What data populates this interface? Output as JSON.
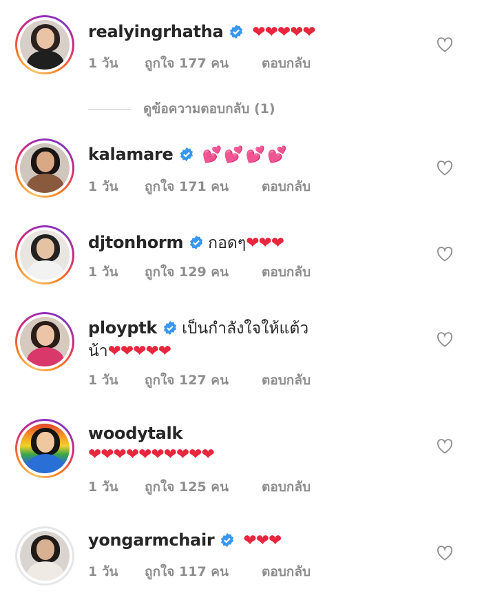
{
  "comments": [
    {
      "username": "realyingrhatha",
      "verified": true,
      "text": "",
      "hearts": "❤❤❤❤❤",
      "time": "1 วัน",
      "likes": "ถูกใจ 177 คน",
      "reply": "ตอบกลับ",
      "avatar_colors": {
        "bg": "#d8cfc9",
        "hair": "#2b2220",
        "skin": "#e8c3a6",
        "body": "#1f1f1f"
      }
    },
    {
      "username": "kalamare",
      "verified": true,
      "text": "",
      "hearts": "💕💕💕💕",
      "time": "1 วัน",
      "likes": "ถูกใจ 171 คน",
      "reply": "ตอบกลับ",
      "avatar_colors": {
        "bg": "#cfc6bd",
        "hair": "#1a1412",
        "skin": "#d9a885",
        "body": "#8a5a3e"
      }
    },
    {
      "username": "djtonhorm",
      "verified": true,
      "text": "กอดๆ",
      "hearts": "❤❤❤",
      "time": "1 วัน",
      "likes": "ถูกใจ 129 คน",
      "reply": "ตอบกลับ",
      "avatar_colors": {
        "bg": "#e9e6e2",
        "hair": "#222222",
        "skin": "#e6c2a4",
        "body": "#f2f2f2"
      }
    },
    {
      "username": "ployptk",
      "verified": true,
      "text": "เป็นกำลังใจให้แต้ว",
      "text_line2": "น้า",
      "hearts": "❤❤❤❤❤",
      "time": "1 วัน",
      "likes": "ถูกใจ 127 คน",
      "reply": "ตอบกลับ",
      "avatar_colors": {
        "bg": "#d6c9bd",
        "hair": "#2a1d18",
        "skin": "#ecc5a8",
        "body": "#d9386b"
      }
    },
    {
      "username": "woodytalk",
      "verified": false,
      "text": "",
      "hearts": "❤❤❤❤❤❤❤❤❤❤",
      "time": "1 วัน",
      "likes": "ถูกใจ 125 คน",
      "reply": "ตอบกลับ",
      "avatar_colors": {
        "bg": "#e4432f",
        "hair": "#151515",
        "skin": "#f0c8a0",
        "body": "#2a6fd6"
      }
    },
    {
      "username": "yongarmchair",
      "verified": true,
      "text": "",
      "hearts": "❤❤❤",
      "time": "1 วัน",
      "likes": "ถูกใจ 117 คน",
      "reply": "ตอบกลับ",
      "avatar_colors": {
        "bg": "#d9d4cf",
        "hair": "#1d1a18",
        "skin": "#d8b092",
        "body": "#efeae4"
      }
    }
  ],
  "view_replies": "ดูข้อความตอบกลับ (1)",
  "icons": {
    "verified": "verified-badge-icon",
    "like": "heart-outline-icon"
  },
  "colors": {
    "verified": "#3897f0",
    "heart": "#e8263d",
    "meta": "#8e8e8e"
  }
}
